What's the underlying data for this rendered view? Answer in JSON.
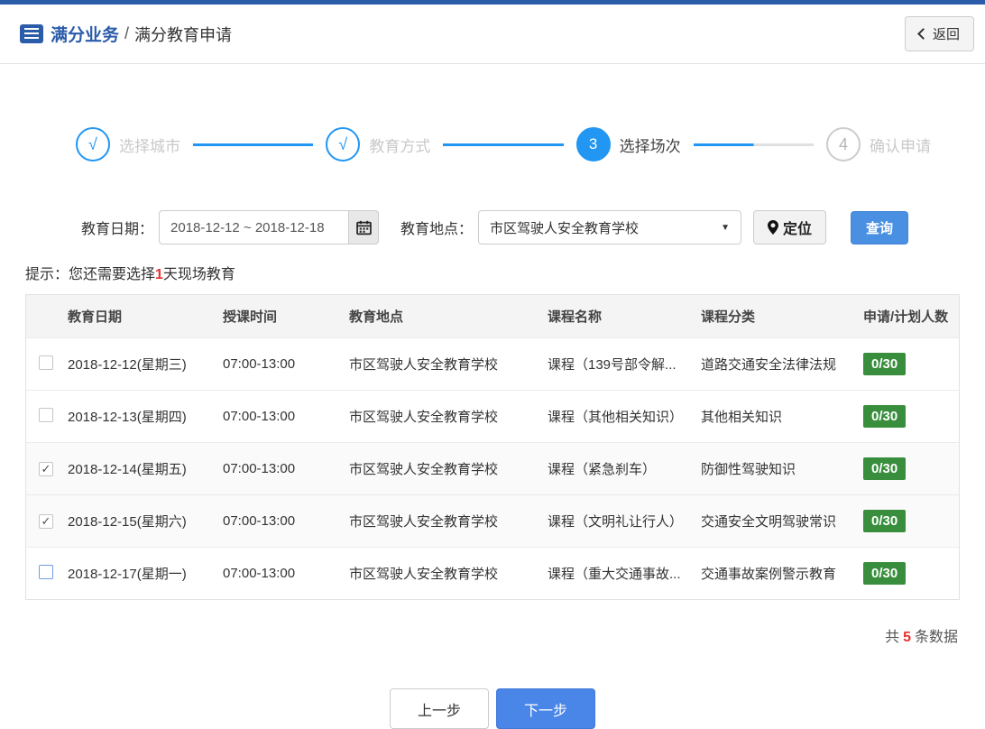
{
  "header": {
    "title_primary": "满分业务",
    "title_separator": "/",
    "title_secondary": "满分教育申请",
    "back_label": "返回",
    "back_icon": "chevron-left"
  },
  "stepper": {
    "steps": [
      {
        "symbol": "√",
        "label": "选择城市",
        "state": "done"
      },
      {
        "symbol": "√",
        "label": "教育方式",
        "state": "done"
      },
      {
        "symbol": "3",
        "label": "选择场次",
        "state": "active"
      },
      {
        "symbol": "4",
        "label": "确认申请",
        "state": "pending"
      }
    ]
  },
  "filters": {
    "date_label": "教育日期：",
    "date_value": "2018-12-12 ~ 2018-12-18",
    "date_icon": "calendar-icon",
    "location_label": "教育地点：",
    "location_value": "市区驾驶人安全教育学校",
    "location_arrow": "▼",
    "locate_label": "定位",
    "locate_icon": "location-pin-icon",
    "search_label": "查询"
  },
  "hint": {
    "prefix": "提示：您还需要选择",
    "highlight": "1",
    "suffix": "天现场教育"
  },
  "table": {
    "columns": [
      "教育日期",
      "授课时间",
      "教育地点",
      "课程名称",
      "课程分类",
      "申请/计划人数"
    ],
    "rows": [
      {
        "checked": false,
        "focused": false,
        "date": "2018-12-12(星期三)",
        "time": "07:00-13:00",
        "location": "市区驾驶人安全教育学校",
        "course": "课程（139号部令解...",
        "category": "道路交通安全法律法规",
        "capacity": "0/30"
      },
      {
        "checked": false,
        "focused": false,
        "date": "2018-12-13(星期四)",
        "time": "07:00-13:00",
        "location": "市区驾驶人安全教育学校",
        "course": "课程（其他相关知识）",
        "category": "其他相关知识",
        "capacity": "0/30"
      },
      {
        "checked": true,
        "focused": false,
        "date": "2018-12-14(星期五)",
        "time": "07:00-13:00",
        "location": "市区驾驶人安全教育学校",
        "course": "课程（紧急刹车）",
        "category": "防御性驾驶知识",
        "capacity": "0/30"
      },
      {
        "checked": true,
        "focused": false,
        "date": "2018-12-15(星期六)",
        "time": "07:00-13:00",
        "location": "市区驾驶人安全教育学校",
        "course": "课程（文明礼让行人）",
        "category": "交通安全文明驾驶常识",
        "capacity": "0/30"
      },
      {
        "checked": false,
        "focused": true,
        "date": "2018-12-17(星期一)",
        "time": "07:00-13:00",
        "location": "市区驾驶人安全教育学校",
        "course": "课程（重大交通事故...",
        "category": "交通事故案例警示教育",
        "capacity": "0/30"
      }
    ]
  },
  "summary": {
    "prefix": "共",
    "count": "5",
    "suffix": "条数据"
  },
  "actions": {
    "prev_label": "上一步",
    "next_label": "下一步"
  },
  "colors": {
    "brand_blue": "#2b5caa",
    "stepper_blue": "#2196f3",
    "button_blue": "#4a90e2",
    "badge_green": "#388e3c",
    "alert_red": "#e8322e"
  }
}
